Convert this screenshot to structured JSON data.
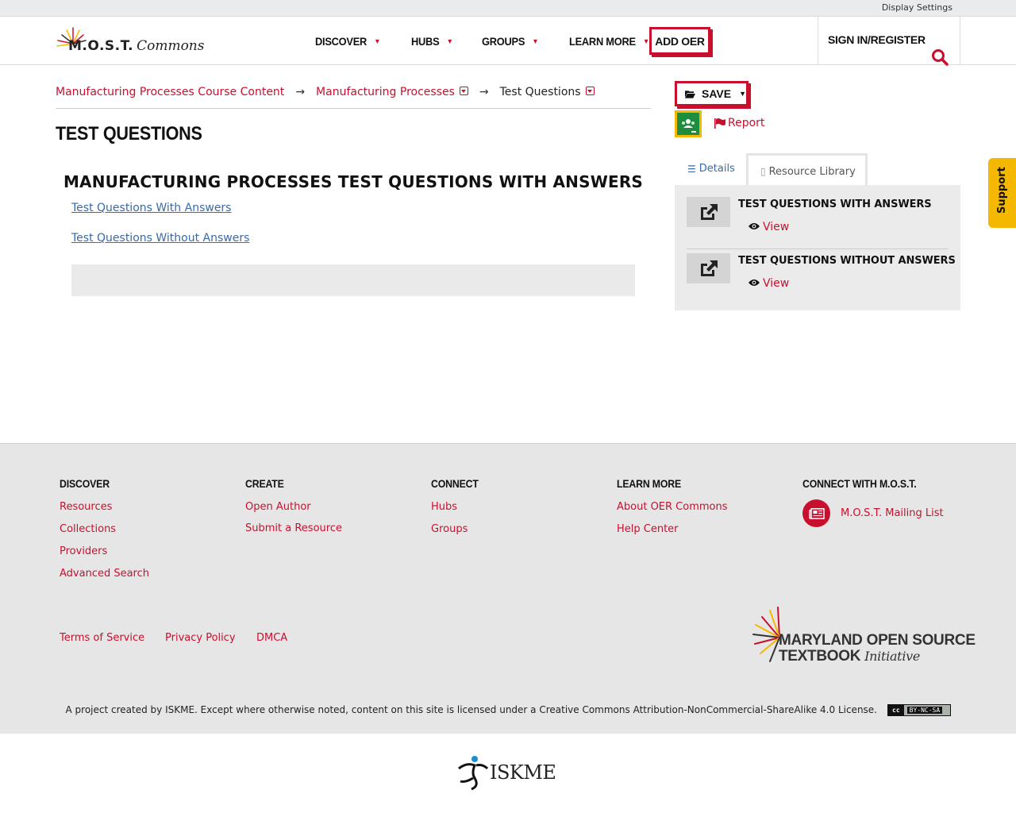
{
  "topbar": {
    "display_settings": "Display Settings"
  },
  "header": {
    "logo": {
      "most": "M.O.S.T.",
      "commons": "Commons"
    },
    "nav": [
      {
        "label": "DISCOVER"
      },
      {
        "label": "HUBS"
      },
      {
        "label": "GROUPS"
      },
      {
        "label": "LEARN MORE"
      }
    ],
    "add_oer": "ADD OER",
    "signin": "SIGN IN/REGISTER"
  },
  "breadcrumb": {
    "items": [
      {
        "label": "Manufacturing Processes Course Content"
      },
      {
        "label": "Manufacturing Processes"
      },
      {
        "label": "Test Questions"
      }
    ],
    "separator": "→"
  },
  "main": {
    "title": "TEST QUESTIONS",
    "content_heading": "MANUFACTURING PROCESSES TEST QUESTIONS WITH ANSWERS",
    "links": [
      {
        "label": "Test Questions With Answers"
      },
      {
        "label": "Test Questions Without Answers"
      }
    ]
  },
  "sidebar": {
    "save_label": "SAVE",
    "report_label": "Report",
    "tabs": [
      {
        "label": "Details"
      },
      {
        "label": "Resource Library"
      }
    ],
    "library": [
      {
        "title": "TEST QUESTIONS WITH ANSWERS",
        "view_label": "View"
      },
      {
        "title": "TEST QUESTIONS WITHOUT ANSWERS",
        "view_label": "View"
      }
    ]
  },
  "support_label": "Support",
  "footer": {
    "discover": {
      "heading": "DISCOVER",
      "links": [
        "Resources",
        "Collections",
        "Providers",
        "Advanced Search"
      ]
    },
    "create": {
      "heading": "CREATE",
      "links": [
        "Open Author",
        "Submit a Resource"
      ]
    },
    "connect": {
      "heading": "CONNECT",
      "links": [
        "Hubs",
        "Groups"
      ]
    },
    "learn_more": {
      "heading": "LEARN MORE",
      "links": [
        "About OER Commons",
        "Help Center"
      ]
    },
    "connect_with": {
      "heading": "CONNECT WITH M.O.S.T.",
      "mailing_list": "M.O.S.T. Mailing List"
    },
    "legal": [
      "Terms of Service",
      "Privacy Policy",
      "DMCA"
    ],
    "mosti_logo": {
      "line1": "MARYLAND OPEN SOURCE",
      "line2": "TEXTBOOK",
      "line3": "Initiative"
    },
    "license_text": "A project created by ISKME. Except where otherwise noted, content on this site is licensed under a Creative Commons Attribution-NonCommercial-ShareAlike 4.0 License.",
    "cc_badge": {
      "cc": "cc",
      "terms": "BY-NC-SA"
    }
  },
  "iskme_label": "ISKME",
  "colors": {
    "accent": "#c8102e",
    "link_blue": "#3a6aa8",
    "support": "#f5b800",
    "footer_bg": "#e6e6e6"
  }
}
